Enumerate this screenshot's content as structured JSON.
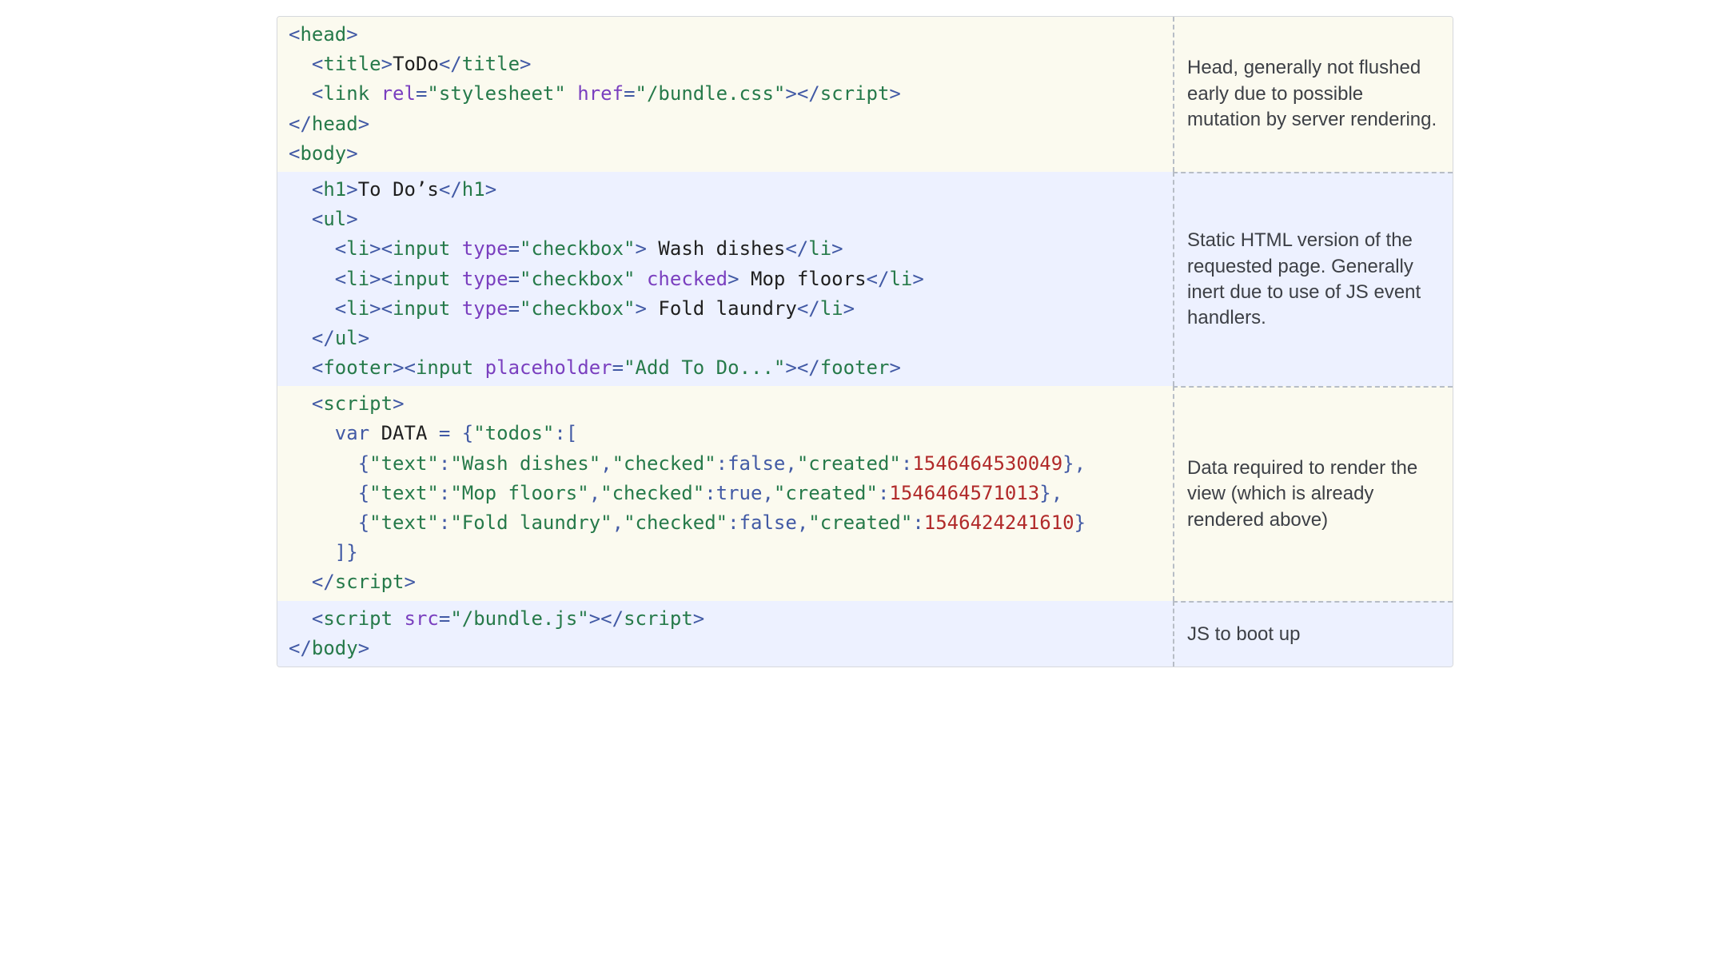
{
  "rows": [
    {
      "band": "yellow",
      "note": "Head, generally not flushed early due to possible mutation by server rendering.",
      "tokens": [
        {
          "c": "p",
          "v": "<"
        },
        {
          "c": "t",
          "v": "head"
        },
        {
          "c": "p",
          "v": ">"
        },
        {
          "c": "id",
          "v": "\n  "
        },
        {
          "c": "p",
          "v": "<"
        },
        {
          "c": "t",
          "v": "title"
        },
        {
          "c": "p",
          "v": ">"
        },
        {
          "c": "id",
          "v": "ToDo"
        },
        {
          "c": "p",
          "v": "</"
        },
        {
          "c": "t",
          "v": "title"
        },
        {
          "c": "p",
          "v": ">"
        },
        {
          "c": "id",
          "v": "\n  "
        },
        {
          "c": "p",
          "v": "<"
        },
        {
          "c": "t",
          "v": "link"
        },
        {
          "c": "id",
          "v": " "
        },
        {
          "c": "a",
          "v": "rel"
        },
        {
          "c": "p",
          "v": "="
        },
        {
          "c": "s",
          "v": "\"stylesheet\""
        },
        {
          "c": "id",
          "v": " "
        },
        {
          "c": "a",
          "v": "href"
        },
        {
          "c": "p",
          "v": "="
        },
        {
          "c": "s",
          "v": "\"/bundle.css\""
        },
        {
          "c": "p",
          "v": ">"
        },
        {
          "c": "p",
          "v": "</"
        },
        {
          "c": "t",
          "v": "script"
        },
        {
          "c": "p",
          "v": ">"
        },
        {
          "c": "id",
          "v": "\n"
        },
        {
          "c": "p",
          "v": "</"
        },
        {
          "c": "t",
          "v": "head"
        },
        {
          "c": "p",
          "v": ">"
        },
        {
          "c": "id",
          "v": "\n"
        },
        {
          "c": "p",
          "v": "<"
        },
        {
          "c": "t",
          "v": "body"
        },
        {
          "c": "p",
          "v": ">"
        }
      ]
    },
    {
      "band": "blue",
      "note": "Static HTML version of the requested page. Generally inert due to use of JS event handlers.",
      "tokens": [
        {
          "c": "id",
          "v": "  "
        },
        {
          "c": "p",
          "v": "<"
        },
        {
          "c": "t",
          "v": "h1"
        },
        {
          "c": "p",
          "v": ">"
        },
        {
          "c": "id",
          "v": "To Do’s"
        },
        {
          "c": "p",
          "v": "</"
        },
        {
          "c": "t",
          "v": "h1"
        },
        {
          "c": "p",
          "v": ">"
        },
        {
          "c": "id",
          "v": "\n  "
        },
        {
          "c": "p",
          "v": "<"
        },
        {
          "c": "t",
          "v": "ul"
        },
        {
          "c": "p",
          "v": ">"
        },
        {
          "c": "id",
          "v": "\n    "
        },
        {
          "c": "p",
          "v": "<"
        },
        {
          "c": "t",
          "v": "li"
        },
        {
          "c": "p",
          "v": ">"
        },
        {
          "c": "p",
          "v": "<"
        },
        {
          "c": "t",
          "v": "input"
        },
        {
          "c": "id",
          "v": " "
        },
        {
          "c": "a",
          "v": "type"
        },
        {
          "c": "p",
          "v": "="
        },
        {
          "c": "s",
          "v": "\"checkbox\""
        },
        {
          "c": "p",
          "v": ">"
        },
        {
          "c": "id",
          "v": " Wash dishes"
        },
        {
          "c": "p",
          "v": "</"
        },
        {
          "c": "t",
          "v": "li"
        },
        {
          "c": "p",
          "v": ">"
        },
        {
          "c": "id",
          "v": "\n    "
        },
        {
          "c": "p",
          "v": "<"
        },
        {
          "c": "t",
          "v": "li"
        },
        {
          "c": "p",
          "v": ">"
        },
        {
          "c": "p",
          "v": "<"
        },
        {
          "c": "t",
          "v": "input"
        },
        {
          "c": "id",
          "v": " "
        },
        {
          "c": "a",
          "v": "type"
        },
        {
          "c": "p",
          "v": "="
        },
        {
          "c": "s",
          "v": "\"checkbox\""
        },
        {
          "c": "id",
          "v": " "
        },
        {
          "c": "a",
          "v": "checked"
        },
        {
          "c": "p",
          "v": ">"
        },
        {
          "c": "id",
          "v": " Mop floors"
        },
        {
          "c": "p",
          "v": "</"
        },
        {
          "c": "t",
          "v": "li"
        },
        {
          "c": "p",
          "v": ">"
        },
        {
          "c": "id",
          "v": "\n    "
        },
        {
          "c": "p",
          "v": "<"
        },
        {
          "c": "t",
          "v": "li"
        },
        {
          "c": "p",
          "v": ">"
        },
        {
          "c": "p",
          "v": "<"
        },
        {
          "c": "t",
          "v": "input"
        },
        {
          "c": "id",
          "v": " "
        },
        {
          "c": "a",
          "v": "type"
        },
        {
          "c": "p",
          "v": "="
        },
        {
          "c": "s",
          "v": "\"checkbox\""
        },
        {
          "c": "p",
          "v": ">"
        },
        {
          "c": "id",
          "v": " Fold laundry"
        },
        {
          "c": "p",
          "v": "</"
        },
        {
          "c": "t",
          "v": "li"
        },
        {
          "c": "p",
          "v": ">"
        },
        {
          "c": "id",
          "v": "\n  "
        },
        {
          "c": "p",
          "v": "</"
        },
        {
          "c": "t",
          "v": "ul"
        },
        {
          "c": "p",
          "v": ">"
        },
        {
          "c": "id",
          "v": "\n  "
        },
        {
          "c": "p",
          "v": "<"
        },
        {
          "c": "t",
          "v": "footer"
        },
        {
          "c": "p",
          "v": ">"
        },
        {
          "c": "p",
          "v": "<"
        },
        {
          "c": "t",
          "v": "input"
        },
        {
          "c": "id",
          "v": " "
        },
        {
          "c": "a",
          "v": "placeholder"
        },
        {
          "c": "p",
          "v": "="
        },
        {
          "c": "s",
          "v": "\"Add To Do...\""
        },
        {
          "c": "p",
          "v": ">"
        },
        {
          "c": "p",
          "v": "</"
        },
        {
          "c": "t",
          "v": "footer"
        },
        {
          "c": "p",
          "v": ">"
        }
      ]
    },
    {
      "band": "yellow",
      "note": "Data required to render the view (which is already rendered above)",
      "tokens": [
        {
          "c": "id",
          "v": "  "
        },
        {
          "c": "p",
          "v": "<"
        },
        {
          "c": "t",
          "v": "script"
        },
        {
          "c": "p",
          "v": ">"
        },
        {
          "c": "id",
          "v": "\n    "
        },
        {
          "c": "k",
          "v": "var"
        },
        {
          "c": "id",
          "v": " DATA "
        },
        {
          "c": "p",
          "v": "="
        },
        {
          "c": "id",
          "v": " "
        },
        {
          "c": "p",
          "v": "{"
        },
        {
          "c": "s",
          "v": "\"todos\""
        },
        {
          "c": "p",
          "v": ":["
        },
        {
          "c": "id",
          "v": "\n      "
        },
        {
          "c": "p",
          "v": "{"
        },
        {
          "c": "s",
          "v": "\"text\""
        },
        {
          "c": "p",
          "v": ":"
        },
        {
          "c": "s",
          "v": "\"Wash dishes\""
        },
        {
          "c": "p",
          "v": ","
        },
        {
          "c": "s",
          "v": "\"checked\""
        },
        {
          "c": "p",
          "v": ":"
        },
        {
          "c": "k",
          "v": "false"
        },
        {
          "c": "p",
          "v": ","
        },
        {
          "c": "s",
          "v": "\"created\""
        },
        {
          "c": "p",
          "v": ":"
        },
        {
          "c": "n",
          "v": "1546464530049"
        },
        {
          "c": "p",
          "v": "},"
        },
        {
          "c": "id",
          "v": "\n      "
        },
        {
          "c": "p",
          "v": "{"
        },
        {
          "c": "s",
          "v": "\"text\""
        },
        {
          "c": "p",
          "v": ":"
        },
        {
          "c": "s",
          "v": "\"Mop floors\""
        },
        {
          "c": "p",
          "v": ","
        },
        {
          "c": "s",
          "v": "\"checked\""
        },
        {
          "c": "p",
          "v": ":"
        },
        {
          "c": "k",
          "v": "true"
        },
        {
          "c": "p",
          "v": ","
        },
        {
          "c": "s",
          "v": "\"created\""
        },
        {
          "c": "p",
          "v": ":"
        },
        {
          "c": "n",
          "v": "1546464571013"
        },
        {
          "c": "p",
          "v": "},"
        },
        {
          "c": "id",
          "v": "\n      "
        },
        {
          "c": "p",
          "v": "{"
        },
        {
          "c": "s",
          "v": "\"text\""
        },
        {
          "c": "p",
          "v": ":"
        },
        {
          "c": "s",
          "v": "\"Fold laundry\""
        },
        {
          "c": "p",
          "v": ","
        },
        {
          "c": "s",
          "v": "\"checked\""
        },
        {
          "c": "p",
          "v": ":"
        },
        {
          "c": "k",
          "v": "false"
        },
        {
          "c": "p",
          "v": ","
        },
        {
          "c": "s",
          "v": "\"created\""
        },
        {
          "c": "p",
          "v": ":"
        },
        {
          "c": "n",
          "v": "1546424241610"
        },
        {
          "c": "p",
          "v": "}"
        },
        {
          "c": "id",
          "v": "\n    "
        },
        {
          "c": "p",
          "v": "]}"
        },
        {
          "c": "id",
          "v": "\n  "
        },
        {
          "c": "p",
          "v": "</"
        },
        {
          "c": "t",
          "v": "script"
        },
        {
          "c": "p",
          "v": ">"
        }
      ]
    },
    {
      "band": "blue",
      "note": "JS to boot up",
      "tokens": [
        {
          "c": "id",
          "v": "  "
        },
        {
          "c": "p",
          "v": "<"
        },
        {
          "c": "t",
          "v": "script"
        },
        {
          "c": "id",
          "v": " "
        },
        {
          "c": "a",
          "v": "src"
        },
        {
          "c": "p",
          "v": "="
        },
        {
          "c": "s",
          "v": "\"/bundle.js\""
        },
        {
          "c": "p",
          "v": ">"
        },
        {
          "c": "p",
          "v": "</"
        },
        {
          "c": "t",
          "v": "script"
        },
        {
          "c": "p",
          "v": ">"
        },
        {
          "c": "id",
          "v": "\n"
        },
        {
          "c": "p",
          "v": "</"
        },
        {
          "c": "t",
          "v": "body"
        },
        {
          "c": "p",
          "v": ">"
        }
      ]
    }
  ]
}
